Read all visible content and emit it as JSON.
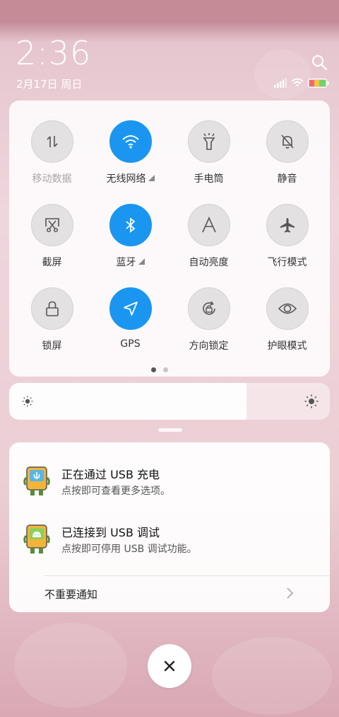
{
  "header": {
    "time": "2:36",
    "date": "2月17日 周日"
  },
  "icons": {
    "search": "search-icon",
    "signal": "signal-icon",
    "wifi": "wifi-icon",
    "battery": "battery-icon"
  },
  "quick_settings": {
    "tiles": [
      {
        "label": "移动数据",
        "icon": "mobile-data-icon",
        "active": false,
        "dim": true,
        "expand": false
      },
      {
        "label": "无线网络",
        "icon": "wifi-icon",
        "active": true,
        "dim": false,
        "expand": true
      },
      {
        "label": "手电筒",
        "icon": "flashlight-icon",
        "active": false,
        "dim": false,
        "expand": false
      },
      {
        "label": "静音",
        "icon": "mute-bell-icon",
        "active": false,
        "dim": false,
        "expand": false
      },
      {
        "label": "截屏",
        "icon": "screenshot-icon",
        "active": false,
        "dim": false,
        "expand": false
      },
      {
        "label": "蓝牙",
        "icon": "bluetooth-icon",
        "active": true,
        "dim": false,
        "expand": true
      },
      {
        "label": "自动亮度",
        "icon": "auto-brightness-icon",
        "active": false,
        "dim": false,
        "expand": false
      },
      {
        "label": "飞行模式",
        "icon": "airplane-icon",
        "active": false,
        "dim": false,
        "expand": false
      },
      {
        "label": "锁屏",
        "icon": "lock-icon",
        "active": false,
        "dim": false,
        "expand": false
      },
      {
        "label": "GPS",
        "icon": "gps-icon",
        "active": true,
        "dim": false,
        "expand": false
      },
      {
        "label": "方向锁定",
        "icon": "rotation-lock-icon",
        "active": false,
        "dim": false,
        "expand": false
      },
      {
        "label": "护眼模式",
        "icon": "eye-icon",
        "active": false,
        "dim": false,
        "expand": false
      }
    ],
    "page_count": 2,
    "current_page": 1
  },
  "brightness": {
    "level": 0.74
  },
  "notifications": [
    {
      "title": "正在通过 USB 充电",
      "text": "点按即可查看更多选项。",
      "icon": "usb-charging-icon"
    },
    {
      "title": "已连接到 USB 调试",
      "text": "点按即可停用 USB 调试功能。",
      "icon": "usb-debug-icon"
    }
  ],
  "unimportant_label": "不重要通知",
  "colors": {
    "accent": "#1a96f0",
    "tile_off": "#e3e1e2"
  }
}
